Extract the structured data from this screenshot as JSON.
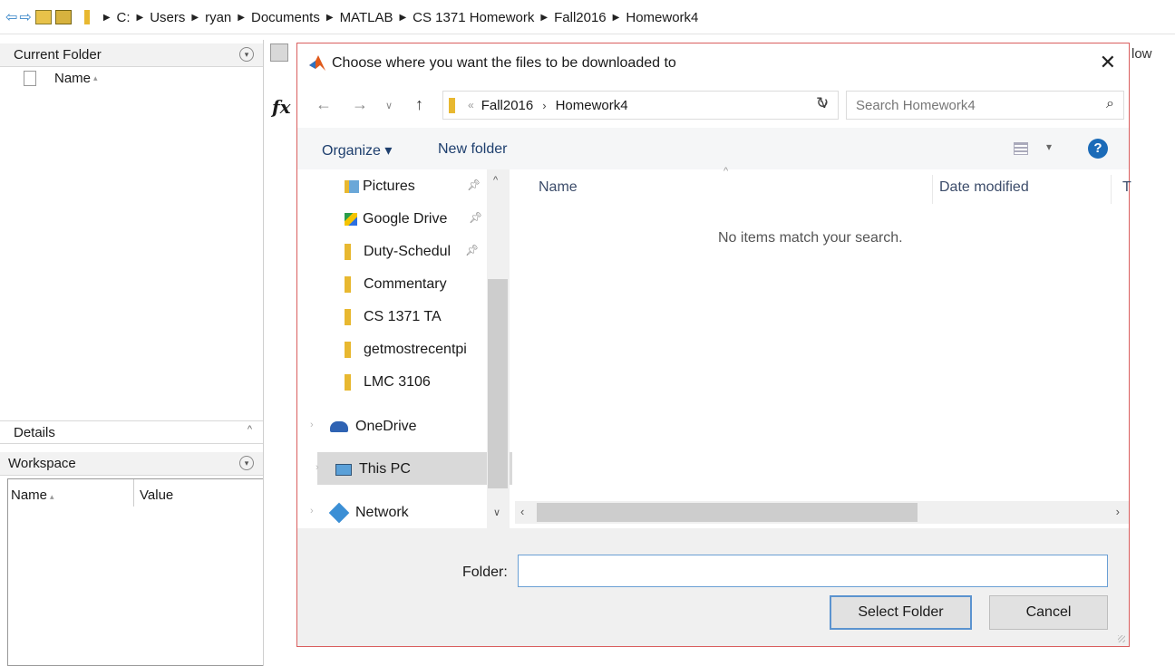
{
  "pathbar": {
    "crumbs": [
      "C:",
      "Users",
      "ryan",
      "Documents",
      "MATLAB",
      "CS 1371 Homework",
      "Fall2016",
      "Homework4"
    ]
  },
  "left": {
    "current_folder_title": "Current Folder",
    "name_col": "Name",
    "details_title": "Details",
    "workspace_title": "Workspace",
    "ws_name_col": "Name",
    "ws_value_col": "Value"
  },
  "background": {
    "fx_label": "fx",
    "partial_label": "low"
  },
  "dialog": {
    "title": "Choose where you want the files to be downloaded to",
    "address": {
      "crumbs": [
        "Fall2016",
        "Homework4"
      ],
      "sep": "«"
    },
    "search_placeholder": "Search Homework4",
    "toolbar": {
      "organize": "Organize ▾",
      "new_folder": "New folder"
    },
    "nav_items": [
      {
        "label": "Pictures",
        "pinned": true
      },
      {
        "label": "Google Drive",
        "pinned": true
      },
      {
        "label": "Duty-Schedul",
        "pinned": true
      },
      {
        "label": "Commentary"
      },
      {
        "label": "CS 1371 TA"
      },
      {
        "label": "getmostrecentpi"
      },
      {
        "label": "LMC 3106"
      },
      {
        "label": "OneDrive"
      },
      {
        "label": "This PC",
        "selected": true
      },
      {
        "label": "Network"
      }
    ],
    "columns": {
      "name": "Name",
      "date_modified": "Date modified",
      "type": "T"
    },
    "empty_message": "No items match your search.",
    "folder_label": "Folder:",
    "folder_value": "",
    "select_button": "Select Folder",
    "cancel_button": "Cancel"
  },
  "colors": {
    "dialog_border": "#d95e5e",
    "folder_yellow": "#e8b830",
    "accent_blue": "#1b6bb8"
  }
}
